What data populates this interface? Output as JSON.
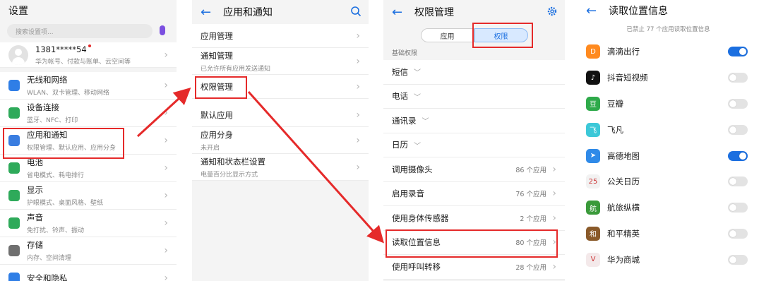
{
  "colors": {
    "accent": "#1b6fe0",
    "highlight": "#e52a2a",
    "toggle_on": "#1b6fe0",
    "toggle_off": "#e3e3e3"
  },
  "panel1": {
    "title": "设置",
    "search_placeholder": "搜索设置项...",
    "account": {
      "name": "1381*****54",
      "sub": "华为帐号、付款与账单、云空间等"
    },
    "items": [
      {
        "title": "无线和网络",
        "sub": "WLAN、双卡管理、移动网络",
        "icon": "wifi-icon",
        "color": "#2f7ee6"
      },
      {
        "title": "设备连接",
        "sub": "蓝牙、NFC、打印",
        "icon": "device-connect-icon",
        "color": "#2eaa5a"
      },
      {
        "title": "应用和通知",
        "sub": "权限管理、默认应用、应用分身",
        "icon": "apps-icon",
        "color": "#3a7de0"
      },
      {
        "title": "电池",
        "sub": "省电模式、耗电排行",
        "icon": "battery-icon",
        "color": "#2eaa5a"
      },
      {
        "title": "显示",
        "sub": "护眼模式、桌面风格、壁纸",
        "icon": "display-icon",
        "color": "#2eaa5a"
      },
      {
        "title": "声音",
        "sub": "免打扰、铃声、振动",
        "icon": "sound-icon",
        "color": "#2eaa5a"
      },
      {
        "title": "存储",
        "sub": "内存、空间清理",
        "icon": "storage-icon",
        "color": "#6f6f6f"
      },
      {
        "title": "安全和隐私",
        "sub": "",
        "icon": "security-icon",
        "color": "#2f7ee6"
      }
    ]
  },
  "panel2": {
    "title": "应用和通知",
    "items": [
      {
        "title": "应用管理",
        "sub": ""
      },
      {
        "title": "通知管理",
        "sub": "已允许所有应用发送通知"
      },
      {
        "title": "权限管理",
        "sub": ""
      },
      {
        "title": "默认应用",
        "sub": ""
      },
      {
        "title": "应用分身",
        "sub": "未开启"
      },
      {
        "title": "通知和状态栏设置",
        "sub": "电量百分比显示方式"
      }
    ]
  },
  "panel3": {
    "title": "权限管理",
    "tabs": [
      "应用",
      "权限"
    ],
    "selected_tab": "权限",
    "section": "基础权限",
    "basic": [
      "短信",
      "电话",
      "通讯录",
      "日历"
    ],
    "items": [
      {
        "title": "调用摄像头",
        "count": "86 个应用"
      },
      {
        "title": "启用录音",
        "count": "76 个应用"
      },
      {
        "title": "使用身体传感器",
        "count": "2 个应用"
      },
      {
        "title": "读取位置信息",
        "count": "80 个应用"
      },
      {
        "title": "使用呼叫转移",
        "count": "28 个应用"
      }
    ]
  },
  "panel4": {
    "title": "读取位置信息",
    "note": "已禁止 77 个应用读取位置信息",
    "apps": [
      {
        "name": "滴滴出行",
        "on": true,
        "color": "#ff8a1f",
        "glyph": "D"
      },
      {
        "name": "抖音短视频",
        "on": false,
        "color": "#111111",
        "glyph": "♪"
      },
      {
        "name": "豆瓣",
        "on": false,
        "color": "#2eaa4a",
        "glyph": "豆"
      },
      {
        "name": "飞凡",
        "on": false,
        "color": "#3cc8d8",
        "glyph": "飞"
      },
      {
        "name": "高德地图",
        "on": true,
        "color": "#2f8ae8",
        "glyph": "➤"
      },
      {
        "name": "公关日历",
        "on": false,
        "color": "#f2f2f2",
        "glyph": "25"
      },
      {
        "name": "航旅纵横",
        "on": false,
        "color": "#3a9a3a",
        "glyph": "航"
      },
      {
        "name": "和平精英",
        "on": false,
        "color": "#8a5a2a",
        "glyph": "和"
      },
      {
        "name": "华为商城",
        "on": false,
        "color": "#f4e9ea",
        "glyph": "V"
      }
    ]
  }
}
